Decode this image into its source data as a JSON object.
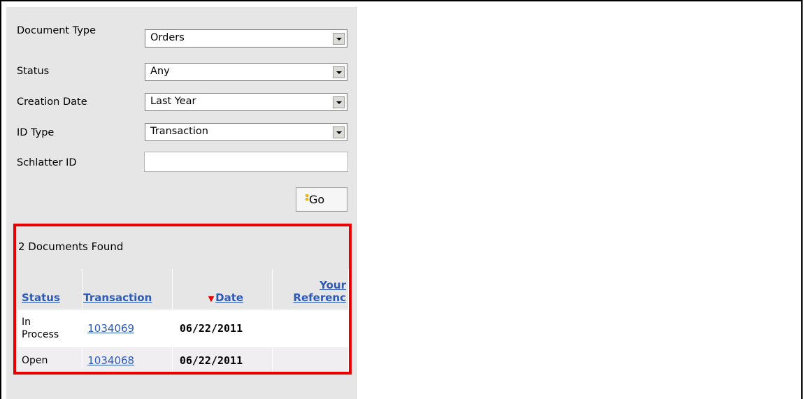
{
  "form": {
    "document_type": {
      "label": "Document Type",
      "value": "Orders"
    },
    "status": {
      "label": "Status",
      "value": "Any"
    },
    "creation_date": {
      "label": "Creation Date",
      "value": "Last Year"
    },
    "id_type": {
      "label": "ID Type",
      "value": "Transaction"
    },
    "schlatter_id": {
      "label": "Schlatter ID",
      "value": ""
    },
    "go_label": "Go"
  },
  "results": {
    "count_text": "2 Documents Found",
    "headers": {
      "status": "Status",
      "transaction": "Transaction",
      "date": "Date",
      "your_ref_line1": "Your",
      "your_ref_line2": "Referenc"
    },
    "rows": [
      {
        "status_line1": "In",
        "status_line2": "Process",
        "transaction": "1034069",
        "date": "06/22/2011",
        "ref": ""
      },
      {
        "status": "Open",
        "transaction": "1034068",
        "date": "06/22/2011",
        "ref": ""
      }
    ]
  },
  "colors": {
    "link": "#2e5ab7",
    "highlight": "#e60000",
    "panel": "#e6e6e6"
  }
}
